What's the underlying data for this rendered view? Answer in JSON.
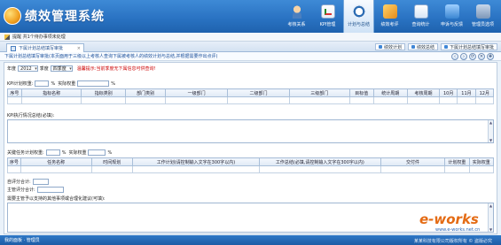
{
  "app": {
    "title": "绩效管理系统"
  },
  "nav": [
    {
      "label": "考核关系",
      "icon": "people-icon"
    },
    {
      "label": "KPI管理",
      "icon": "kpi-icon"
    },
    {
      "label": "计划与总结",
      "icon": "plan-icon",
      "active": true
    },
    {
      "label": "绩效考评",
      "icon": "eval-icon"
    },
    {
      "label": "查询统计",
      "icon": "query-icon"
    },
    {
      "label": "申诉与反馈",
      "icon": "feedback-icon"
    },
    {
      "label": "管理员选项",
      "icon": "admin-icon"
    }
  ],
  "info": {
    "text": "提醒 共1个待办事项未处理"
  },
  "tab": {
    "label": "下属计划总结填写审批"
  },
  "tab_actions": [
    "绩效计划",
    "绩效总结",
    "下属计划总结填写审批"
  ],
  "breadcrumb": "下属计划总结填写审批(本页面用于三级以上考核人查询下属被考核人的绩效计划与总结,并根据需要作出点评)",
  "nav_buttons": [
    "‹",
    "›",
    "⟳",
    "✕",
    "✚"
  ],
  "filters": {
    "year_label": "年度",
    "year_value": "2012",
    "quarter_label": "季度",
    "quarter_value": "四季度",
    "hint": "温馨提示:当前季度无下属信息可供查询!"
  },
  "kpi": {
    "plan_weight_label": "KPI计划权重:",
    "unit1": "%",
    "actual_weight_label": "实际权重",
    "unit2": "%",
    "columns": [
      "序号",
      "指标名称",
      "指标类别",
      "部门类别",
      "一级部门",
      "二级部门",
      "三级部门",
      "目标值",
      "统计周期",
      "考核周期",
      "10月",
      "11月",
      "12月"
    ]
  },
  "kpi_notes": {
    "label": "KPI执行情况总结(必填):"
  },
  "tasks": {
    "plan_weight_label": "关键任务计划权重:",
    "unit1": "%",
    "actual_weight_label": "实际权重",
    "unit2": "%",
    "columns": [
      "序号",
      "任务名称",
      "时间规划",
      "工作计划(请控制输入文字在300字以内)",
      "工作总结(必填,请控制输入文字在300字以内)",
      "交付件",
      "计划权重",
      "实际权重"
    ]
  },
  "scores": {
    "self_label": "自评分合计:",
    "manager_label": "主管评分合计:"
  },
  "suggestion": {
    "label": "需要主管予以支持的其他事项或合理化建议(可填):"
  },
  "footer": {
    "left": "我的面板 · 管理员",
    "right": "某某科技有限公司版权所有 ©  盗版必究"
  },
  "watermark": {
    "main": "e-works",
    "sub": "www.e-works.net.cn"
  },
  "colors": {
    "header": "#2a73c3",
    "accent": "#e46b14",
    "hint": "#cc0000"
  }
}
